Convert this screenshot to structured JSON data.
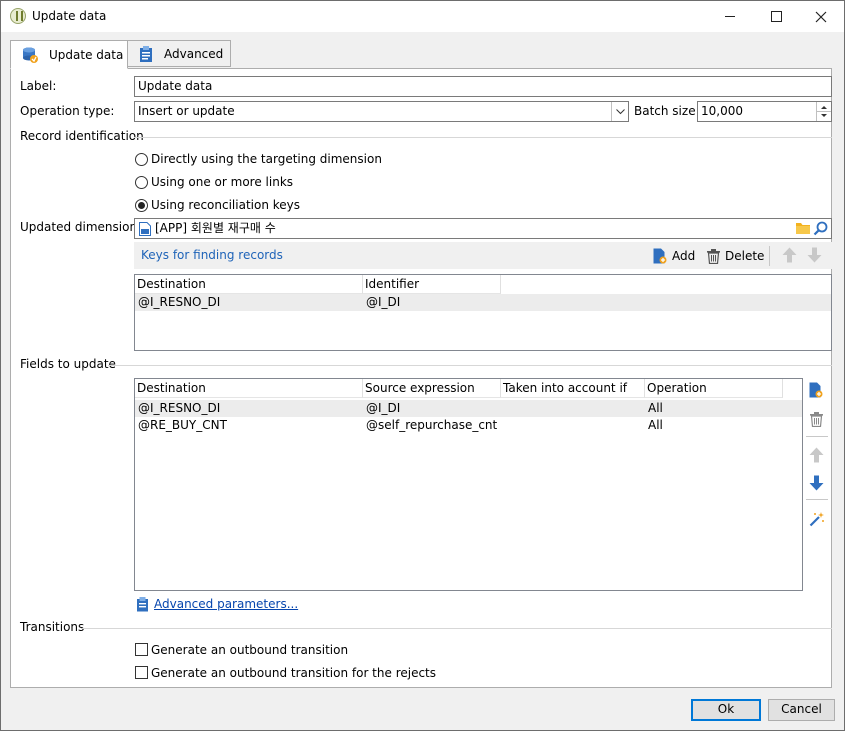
{
  "window": {
    "title": "Update data"
  },
  "tabs": [
    {
      "label": "Update data"
    },
    {
      "label": "Advanced"
    }
  ],
  "form": {
    "label_caption": "Label:",
    "label_value": "Update data",
    "operation_caption": "Operation type:",
    "operation_value": "Insert or update",
    "batch_caption": "Batch size:",
    "batch_value": "10,000"
  },
  "record_identification": {
    "heading": "Record identification",
    "options": [
      {
        "label": "Directly using the targeting dimension",
        "checked": false
      },
      {
        "label": "Using one or more links",
        "checked": false
      },
      {
        "label": "Using reconciliation keys",
        "checked": true
      }
    ]
  },
  "updated_dimension": {
    "caption": "Updated dimension:",
    "value": "[APP] 회원별 재구매 수"
  },
  "keys": {
    "title": "Keys for finding records",
    "add_label": "Add",
    "delete_label": "Delete",
    "columns": [
      "Destination",
      "Identifier"
    ],
    "rows": [
      {
        "destination": "@I_RESNO_DI",
        "identifier": "@I_DI"
      }
    ]
  },
  "fields": {
    "heading": "Fields to update",
    "columns": [
      "Destination",
      "Source expression",
      "Taken into account if",
      "Operation"
    ],
    "rows": [
      {
        "destination": "@I_RESNO_DI",
        "source": "@I_DI",
        "condition": "",
        "operation": "All"
      },
      {
        "destination": "@RE_BUY_CNT",
        "source": "@self_repurchase_cnt",
        "condition": "",
        "operation": "All"
      }
    ],
    "advanced_link": "Advanced parameters..."
  },
  "transitions": {
    "heading": "Transitions",
    "options": [
      {
        "label": "Generate an outbound transition",
        "checked": false
      },
      {
        "label": "Generate an outbound transition for the rejects",
        "checked": false
      }
    ]
  },
  "buttons": {
    "ok_label": "Ok",
    "cancel_label": "Cancel"
  },
  "colors": {
    "accent": "#0078d7",
    "link": "#0645ad",
    "keys_title": "#1e63b8"
  }
}
